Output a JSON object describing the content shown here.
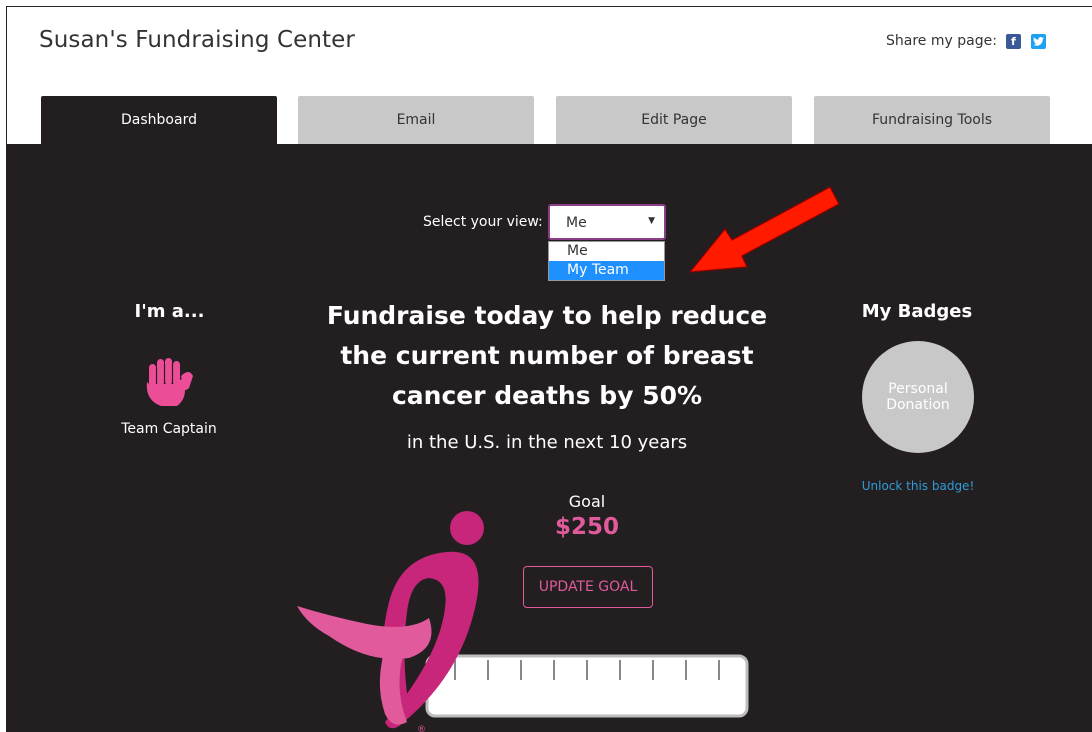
{
  "header": {
    "title": "Susan's Fundraising Center",
    "share_label": "Share my page:",
    "facebook_glyph": "f",
    "twitter_glyph": "t"
  },
  "tabs": [
    {
      "label": "Dashboard",
      "active": true
    },
    {
      "label": "Email",
      "active": false
    },
    {
      "label": "Edit Page",
      "active": false
    },
    {
      "label": "Fundraising Tools",
      "active": false
    }
  ],
  "view_selector": {
    "label": "Select your view:",
    "selected": "Me",
    "options": [
      "Me",
      "My Team"
    ],
    "highlighted": "My Team"
  },
  "role": {
    "heading": "I'm a...",
    "title": "Team Captain",
    "icon": "high-five-hands-icon"
  },
  "headline": {
    "main": "Fundraise today to help reduce the current number of breast cancer deaths by 50%",
    "sub": "in the U.S. in the next 10 years"
  },
  "goal": {
    "label": "Goal",
    "amount": "$250",
    "button_label": "UPDATE GOAL",
    "progress_fraction": 0
  },
  "badges": {
    "title": "My Badges",
    "badge_label": "Personal Donation",
    "unlock_link": "Unlock this badge!"
  },
  "colors": {
    "background_dark": "#231f20",
    "accent_pink": "#e05a9c",
    "tab_inactive": "#c8c8c8",
    "link_blue": "#2e9bd6",
    "annotation_red": "#ff1a00"
  }
}
